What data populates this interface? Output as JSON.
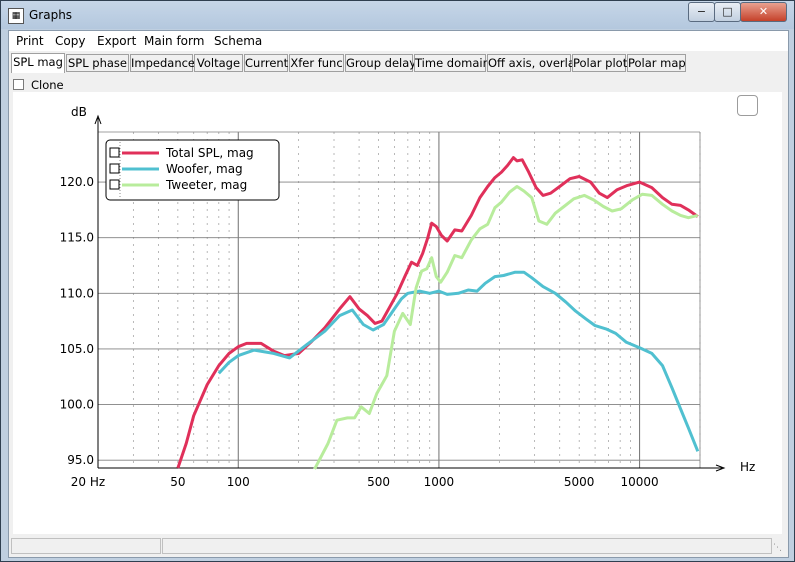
{
  "window": {
    "title": "Graphs",
    "min_label": "−",
    "max_label": "□",
    "close_label": "✕"
  },
  "menu": {
    "items": [
      "Print",
      "Copy",
      "Export",
      "Main form",
      "Schema"
    ]
  },
  "tabs": [
    "SPL mag",
    "SPL phase",
    "Impedance",
    "Voltage",
    "Current",
    "Xfer func",
    "Group delay",
    "Time domain",
    "Off axis, overlay",
    "Polar plot",
    "Polar map"
  ],
  "active_tab": "SPL mag",
  "clone": {
    "label": "Clone",
    "checked": false
  },
  "chart_data": {
    "type": "line",
    "xlabel": "Hz",
    "ylabel": "dB",
    "x_scale": "log",
    "xlim": [
      20,
      20000
    ],
    "ylim": [
      94.3,
      124.5
    ],
    "grid": true,
    "legend_position": "top-left",
    "y_ticks": [
      "120.0",
      "115.0",
      "110.0",
      "105.0",
      "100.0",
      "95.0"
    ],
    "y_tick_values": [
      120,
      115,
      110,
      105,
      100,
      95
    ],
    "x_ticks": [
      "20 Hz",
      "50",
      "100",
      "500",
      "1000",
      "5000",
      "10000"
    ],
    "x_tick_values": [
      20,
      50,
      100,
      500,
      1000,
      5000,
      10000
    ],
    "series": [
      {
        "name": "Total SPL, mag",
        "color": "#e0305a",
        "points": [
          [
            50,
            94.3
          ],
          [
            55,
            96.5
          ],
          [
            60,
            99.0
          ],
          [
            70,
            101.8
          ],
          [
            80,
            103.5
          ],
          [
            90,
            104.6
          ],
          [
            100,
            105.2
          ],
          [
            110,
            105.5
          ],
          [
            130,
            105.5
          ],
          [
            150,
            104.8
          ],
          [
            170,
            104.4
          ],
          [
            200,
            104.6
          ],
          [
            230,
            105.6
          ],
          [
            270,
            106.9
          ],
          [
            320,
            108.6
          ],
          [
            360,
            109.7
          ],
          [
            400,
            108.6
          ],
          [
            440,
            108.0
          ],
          [
            480,
            107.3
          ],
          [
            520,
            107.5
          ],
          [
            570,
            108.8
          ],
          [
            620,
            110.0
          ],
          [
            680,
            111.6
          ],
          [
            730,
            112.8
          ],
          [
            780,
            112.5
          ],
          [
            830,
            113.6
          ],
          [
            880,
            115.0
          ],
          [
            920,
            116.3
          ],
          [
            970,
            116.0
          ],
          [
            1030,
            115.2
          ],
          [
            1100,
            114.7
          ],
          [
            1200,
            115.7
          ],
          [
            1300,
            115.6
          ],
          [
            1450,
            117.0
          ],
          [
            1600,
            118.6
          ],
          [
            1750,
            119.6
          ],
          [
            1900,
            120.4
          ],
          [
            2050,
            120.9
          ],
          [
            2200,
            121.5
          ],
          [
            2350,
            122.2
          ],
          [
            2450,
            121.9
          ],
          [
            2600,
            122.0
          ],
          [
            2800,
            120.9
          ],
          [
            3050,
            119.5
          ],
          [
            3300,
            118.8
          ],
          [
            3600,
            119.0
          ],
          [
            4000,
            119.6
          ],
          [
            4500,
            120.3
          ],
          [
            5000,
            120.5
          ],
          [
            5700,
            120.0
          ],
          [
            6300,
            119.0
          ],
          [
            6900,
            118.6
          ],
          [
            7700,
            119.3
          ],
          [
            8700,
            119.7
          ],
          [
            10000,
            120.0
          ],
          [
            11500,
            119.5
          ],
          [
            13000,
            118.6
          ],
          [
            14500,
            118.0
          ],
          [
            16000,
            117.9
          ],
          [
            17500,
            117.5
          ],
          [
            19500,
            116.9
          ]
        ]
      },
      {
        "name": "Woofer, mag",
        "color": "#50c0d0",
        "points": [
          [
            80,
            102.8
          ],
          [
            90,
            103.8
          ],
          [
            100,
            104.4
          ],
          [
            120,
            104.9
          ],
          [
            150,
            104.6
          ],
          [
            180,
            104.2
          ],
          [
            220,
            105.4
          ],
          [
            270,
            106.6
          ],
          [
            320,
            108.0
          ],
          [
            370,
            108.5
          ],
          [
            420,
            107.2
          ],
          [
            470,
            106.7
          ],
          [
            530,
            107.2
          ],
          [
            600,
            108.6
          ],
          [
            650,
            109.5
          ],
          [
            700,
            110.0
          ],
          [
            800,
            110.2
          ],
          [
            900,
            110.0
          ],
          [
            1000,
            110.2
          ],
          [
            1100,
            109.9
          ],
          [
            1250,
            110.0
          ],
          [
            1400,
            110.3
          ],
          [
            1550,
            110.2
          ],
          [
            1700,
            110.9
          ],
          [
            1900,
            111.5
          ],
          [
            2100,
            111.6
          ],
          [
            2400,
            111.9
          ],
          [
            2650,
            111.9
          ],
          [
            2900,
            111.4
          ],
          [
            3300,
            110.6
          ],
          [
            3800,
            110.0
          ],
          [
            4300,
            109.2
          ],
          [
            4800,
            108.4
          ],
          [
            5400,
            107.7
          ],
          [
            6000,
            107.1
          ],
          [
            6800,
            106.8
          ],
          [
            7600,
            106.4
          ],
          [
            8600,
            105.6
          ],
          [
            10000,
            105.1
          ],
          [
            11500,
            104.6
          ],
          [
            13000,
            103.5
          ],
          [
            14500,
            101.5
          ],
          [
            16000,
            99.6
          ],
          [
            17500,
            97.9
          ],
          [
            19500,
            95.8
          ]
        ]
      },
      {
        "name": "Tweeter, mag",
        "color": "#b8ec9c",
        "points": [
          [
            240,
            94.2
          ],
          [
            280,
            96.5
          ],
          [
            310,
            98.6
          ],
          [
            350,
            98.8
          ],
          [
            380,
            98.8
          ],
          [
            410,
            99.8
          ],
          [
            450,
            99.2
          ],
          [
            490,
            101.0
          ],
          [
            550,
            102.6
          ],
          [
            600,
            106.6
          ],
          [
            660,
            108.2
          ],
          [
            720,
            107.2
          ],
          [
            770,
            110.5
          ],
          [
            820,
            112.0
          ],
          [
            870,
            112.2
          ],
          [
            920,
            113.2
          ],
          [
            970,
            111.5
          ],
          [
            1020,
            111.0
          ],
          [
            1100,
            111.9
          ],
          [
            1200,
            113.4
          ],
          [
            1300,
            113.2
          ],
          [
            1450,
            114.8
          ],
          [
            1600,
            115.8
          ],
          [
            1750,
            116.2
          ],
          [
            1900,
            117.7
          ],
          [
            2050,
            118.2
          ],
          [
            2250,
            119.1
          ],
          [
            2450,
            119.6
          ],
          [
            2650,
            119.2
          ],
          [
            2900,
            118.6
          ],
          [
            3150,
            116.5
          ],
          [
            3450,
            116.2
          ],
          [
            3800,
            117.2
          ],
          [
            4200,
            117.8
          ],
          [
            4700,
            118.5
          ],
          [
            5300,
            118.8
          ],
          [
            5900,
            118.4
          ],
          [
            6600,
            117.8
          ],
          [
            7300,
            117.4
          ],
          [
            8100,
            117.6
          ],
          [
            9200,
            118.4
          ],
          [
            10300,
            118.9
          ],
          [
            11500,
            118.8
          ],
          [
            13000,
            118.0
          ],
          [
            14500,
            117.4
          ],
          [
            16000,
            117.0
          ],
          [
            17500,
            116.8
          ],
          [
            19500,
            117.0
          ]
        ]
      }
    ]
  }
}
